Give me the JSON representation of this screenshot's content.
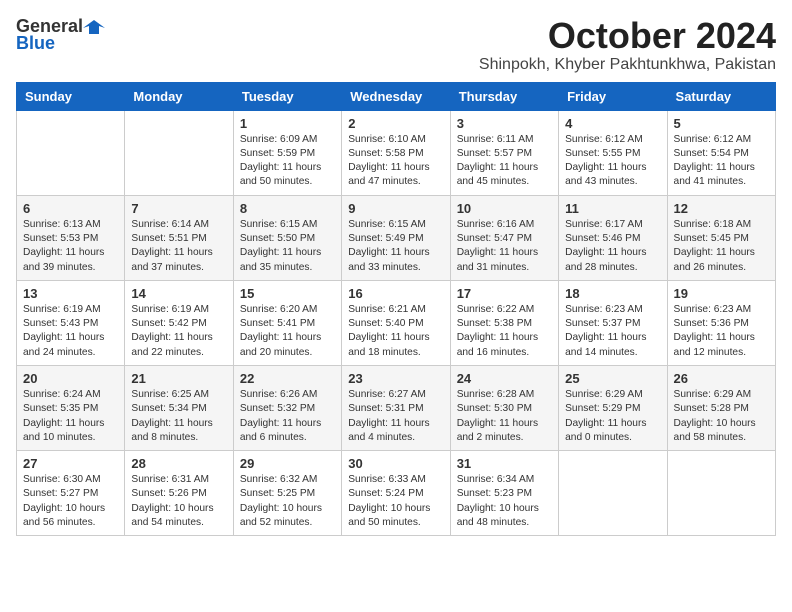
{
  "header": {
    "logo_general": "General",
    "logo_blue": "Blue",
    "month_year": "October 2024",
    "location": "Shinpokh, Khyber Pakhtunkhwa, Pakistan"
  },
  "weekdays": [
    "Sunday",
    "Monday",
    "Tuesday",
    "Wednesday",
    "Thursday",
    "Friday",
    "Saturday"
  ],
  "weeks": [
    [
      {
        "day": "",
        "info": ""
      },
      {
        "day": "",
        "info": ""
      },
      {
        "day": "1",
        "info": "Sunrise: 6:09 AM\nSunset: 5:59 PM\nDaylight: 11 hours and 50 minutes."
      },
      {
        "day": "2",
        "info": "Sunrise: 6:10 AM\nSunset: 5:58 PM\nDaylight: 11 hours and 47 minutes."
      },
      {
        "day": "3",
        "info": "Sunrise: 6:11 AM\nSunset: 5:57 PM\nDaylight: 11 hours and 45 minutes."
      },
      {
        "day": "4",
        "info": "Sunrise: 6:12 AM\nSunset: 5:55 PM\nDaylight: 11 hours and 43 minutes."
      },
      {
        "day": "5",
        "info": "Sunrise: 6:12 AM\nSunset: 5:54 PM\nDaylight: 11 hours and 41 minutes."
      }
    ],
    [
      {
        "day": "6",
        "info": "Sunrise: 6:13 AM\nSunset: 5:53 PM\nDaylight: 11 hours and 39 minutes."
      },
      {
        "day": "7",
        "info": "Sunrise: 6:14 AM\nSunset: 5:51 PM\nDaylight: 11 hours and 37 minutes."
      },
      {
        "day": "8",
        "info": "Sunrise: 6:15 AM\nSunset: 5:50 PM\nDaylight: 11 hours and 35 minutes."
      },
      {
        "day": "9",
        "info": "Sunrise: 6:15 AM\nSunset: 5:49 PM\nDaylight: 11 hours and 33 minutes."
      },
      {
        "day": "10",
        "info": "Sunrise: 6:16 AM\nSunset: 5:47 PM\nDaylight: 11 hours and 31 minutes."
      },
      {
        "day": "11",
        "info": "Sunrise: 6:17 AM\nSunset: 5:46 PM\nDaylight: 11 hours and 28 minutes."
      },
      {
        "day": "12",
        "info": "Sunrise: 6:18 AM\nSunset: 5:45 PM\nDaylight: 11 hours and 26 minutes."
      }
    ],
    [
      {
        "day": "13",
        "info": "Sunrise: 6:19 AM\nSunset: 5:43 PM\nDaylight: 11 hours and 24 minutes."
      },
      {
        "day": "14",
        "info": "Sunrise: 6:19 AM\nSunset: 5:42 PM\nDaylight: 11 hours and 22 minutes."
      },
      {
        "day": "15",
        "info": "Sunrise: 6:20 AM\nSunset: 5:41 PM\nDaylight: 11 hours and 20 minutes."
      },
      {
        "day": "16",
        "info": "Sunrise: 6:21 AM\nSunset: 5:40 PM\nDaylight: 11 hours and 18 minutes."
      },
      {
        "day": "17",
        "info": "Sunrise: 6:22 AM\nSunset: 5:38 PM\nDaylight: 11 hours and 16 minutes."
      },
      {
        "day": "18",
        "info": "Sunrise: 6:23 AM\nSunset: 5:37 PM\nDaylight: 11 hours and 14 minutes."
      },
      {
        "day": "19",
        "info": "Sunrise: 6:23 AM\nSunset: 5:36 PM\nDaylight: 11 hours and 12 minutes."
      }
    ],
    [
      {
        "day": "20",
        "info": "Sunrise: 6:24 AM\nSunset: 5:35 PM\nDaylight: 11 hours and 10 minutes."
      },
      {
        "day": "21",
        "info": "Sunrise: 6:25 AM\nSunset: 5:34 PM\nDaylight: 11 hours and 8 minutes."
      },
      {
        "day": "22",
        "info": "Sunrise: 6:26 AM\nSunset: 5:32 PM\nDaylight: 11 hours and 6 minutes."
      },
      {
        "day": "23",
        "info": "Sunrise: 6:27 AM\nSunset: 5:31 PM\nDaylight: 11 hours and 4 minutes."
      },
      {
        "day": "24",
        "info": "Sunrise: 6:28 AM\nSunset: 5:30 PM\nDaylight: 11 hours and 2 minutes."
      },
      {
        "day": "25",
        "info": "Sunrise: 6:29 AM\nSunset: 5:29 PM\nDaylight: 11 hours and 0 minutes."
      },
      {
        "day": "26",
        "info": "Sunrise: 6:29 AM\nSunset: 5:28 PM\nDaylight: 10 hours and 58 minutes."
      }
    ],
    [
      {
        "day": "27",
        "info": "Sunrise: 6:30 AM\nSunset: 5:27 PM\nDaylight: 10 hours and 56 minutes."
      },
      {
        "day": "28",
        "info": "Sunrise: 6:31 AM\nSunset: 5:26 PM\nDaylight: 10 hours and 54 minutes."
      },
      {
        "day": "29",
        "info": "Sunrise: 6:32 AM\nSunset: 5:25 PM\nDaylight: 10 hours and 52 minutes."
      },
      {
        "day": "30",
        "info": "Sunrise: 6:33 AM\nSunset: 5:24 PM\nDaylight: 10 hours and 50 minutes."
      },
      {
        "day": "31",
        "info": "Sunrise: 6:34 AM\nSunset: 5:23 PM\nDaylight: 10 hours and 48 minutes."
      },
      {
        "day": "",
        "info": ""
      },
      {
        "day": "",
        "info": ""
      }
    ]
  ]
}
